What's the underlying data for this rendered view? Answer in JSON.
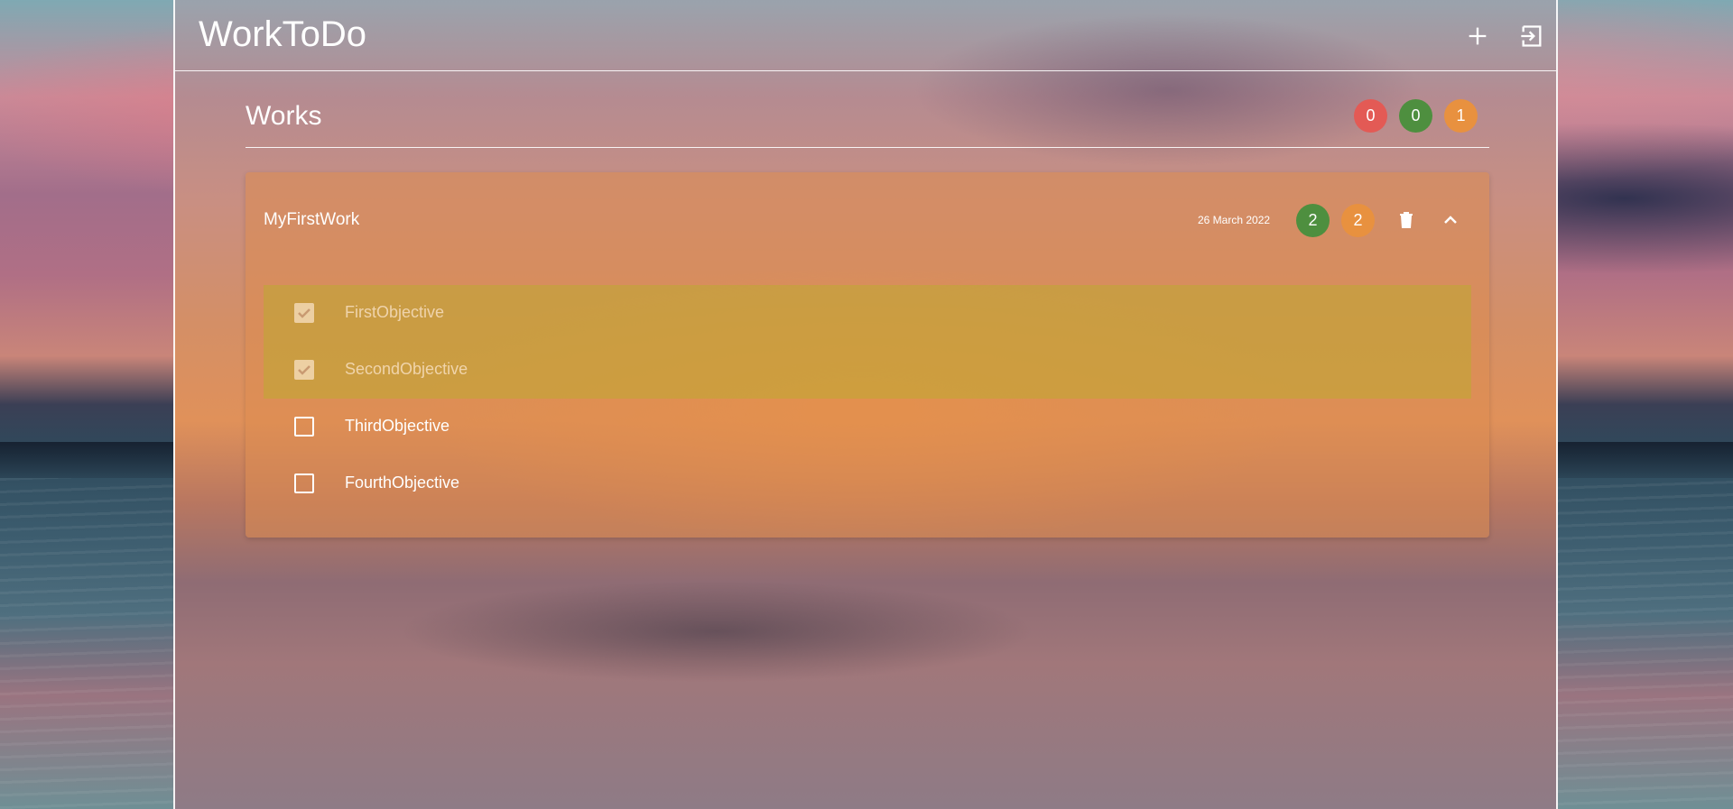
{
  "app": {
    "title": "WorkToDo"
  },
  "section": {
    "title": "Works",
    "counters": [
      {
        "value": "0",
        "color": "#e35a55"
      },
      {
        "value": "0",
        "color": "#4e8f3f"
      },
      {
        "value": "1",
        "color": "#e8913f"
      }
    ]
  },
  "work": {
    "title": "MyFirstWork",
    "date": "26 March 2022",
    "done_count": "2",
    "todo_count": "2",
    "done_color": "#4e8f3f",
    "todo_color": "#e8913f",
    "objectives": [
      {
        "label": "FirstObjective",
        "checked": true
      },
      {
        "label": "SecondObjective",
        "checked": true
      },
      {
        "label": "ThirdObjective",
        "checked": false
      },
      {
        "label": "FourthObjective",
        "checked": false
      }
    ]
  },
  "icons": {
    "add": "add-icon",
    "logout": "logout-icon",
    "delete": "trash-icon",
    "collapse": "chevron-up-icon",
    "checked": "checkbox-checked-icon",
    "unchecked": "checkbox-empty-icon"
  }
}
